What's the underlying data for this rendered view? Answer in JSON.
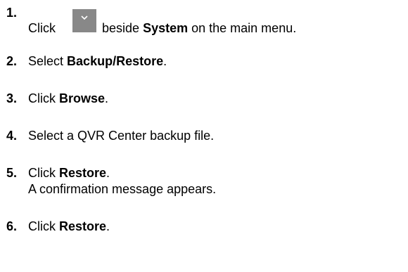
{
  "steps": [
    {
      "num": "1.",
      "pre": "Click",
      "post": "beside",
      "bold": "System",
      "tail": "on the main menu.",
      "icon": "chevron-down-icon",
      "icon_bg": "#888888"
    },
    {
      "num": "2.",
      "pre": "Select",
      "bold": "Backup/Restore",
      "tail": "."
    },
    {
      "num": "3.",
      "pre": "Click",
      "bold": "Browse",
      "tail": "."
    },
    {
      "num": "4.",
      "text": "Select a QVR Center backup file."
    },
    {
      "num": "5.",
      "pre": "Click",
      "bold": "Restore",
      "tail": ".",
      "sub": "A confirmation message appears."
    },
    {
      "num": "6.",
      "pre": "Click",
      "bold": "Restore",
      "tail": "."
    }
  ]
}
